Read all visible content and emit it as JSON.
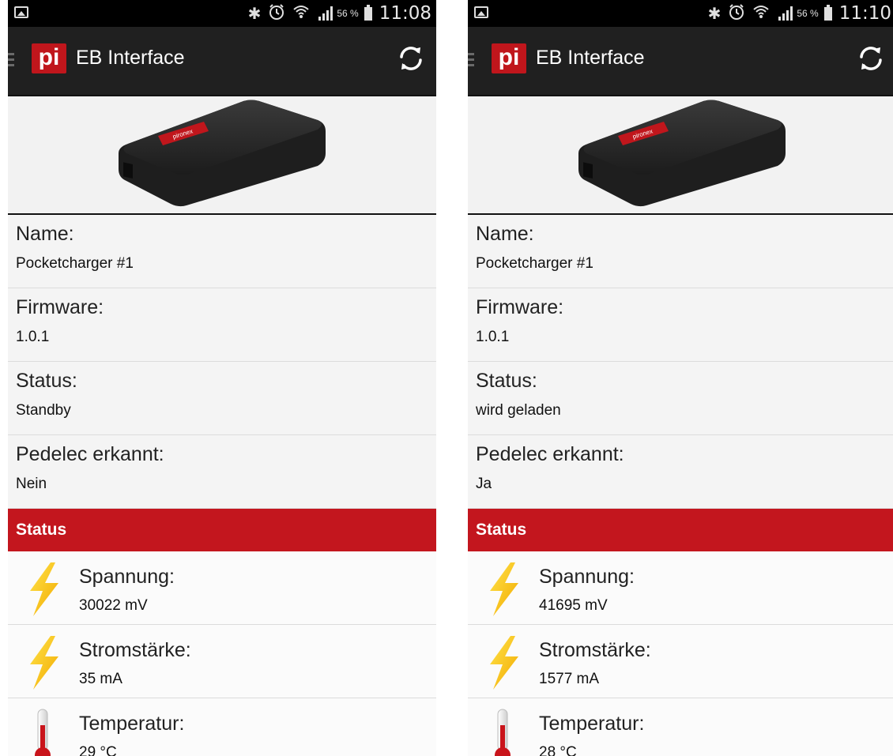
{
  "colors": {
    "accent": "#c3161e",
    "actionbar": "#202020",
    "statusbar": "#000000"
  },
  "screens": [
    {
      "statusbar": {
        "battery_pct": "56 %",
        "time": "11:08",
        "icons": [
          "gallery-icon",
          "bluetooth-icon",
          "alarm-icon",
          "wifi-icon",
          "signal-icon",
          "battery-icon"
        ]
      },
      "app": {
        "logo": "pi",
        "title": "EB Interface",
        "refresh_icon": "refresh-icon"
      },
      "device_brand": "pironex",
      "fields": [
        {
          "label": "Name:",
          "value": "Pocketcharger #1"
        },
        {
          "label": "Firmware:",
          "value": "1.0.1"
        },
        {
          "label": "Status:",
          "value": "Standby"
        },
        {
          "label": "Pedelec erkannt:",
          "value": "Nein"
        }
      ],
      "section": "Status",
      "metrics": [
        {
          "icon": "lightning-icon",
          "label": "Spannung:",
          "value": "30022 mV"
        },
        {
          "icon": "lightning-icon",
          "label": "Stromstärke:",
          "value": "35 mA"
        },
        {
          "icon": "thermometer-icon",
          "label": "Temperatur:",
          "value": "29 °C"
        }
      ]
    },
    {
      "statusbar": {
        "battery_pct": "56 %",
        "time": "11:10",
        "icons": [
          "gallery-icon",
          "bluetooth-icon",
          "alarm-icon",
          "wifi-icon",
          "signal-icon",
          "battery-icon"
        ]
      },
      "app": {
        "logo": "pi",
        "title": "EB Interface",
        "refresh_icon": "refresh-icon"
      },
      "device_brand": "pironex",
      "fields": [
        {
          "label": "Name:",
          "value": "Pocketcharger #1"
        },
        {
          "label": "Firmware:",
          "value": "1.0.1"
        },
        {
          "label": "Status:",
          "value": "wird geladen"
        },
        {
          "label": "Pedelec erkannt:",
          "value": "Ja"
        }
      ],
      "section": "Status",
      "metrics": [
        {
          "icon": "lightning-icon",
          "label": "Spannung:",
          "value": "41695 mV"
        },
        {
          "icon": "lightning-icon",
          "label": "Stromstärke:",
          "value": "1577 mA"
        },
        {
          "icon": "thermometer-icon",
          "label": "Temperatur:",
          "value": "28 °C"
        }
      ]
    }
  ]
}
